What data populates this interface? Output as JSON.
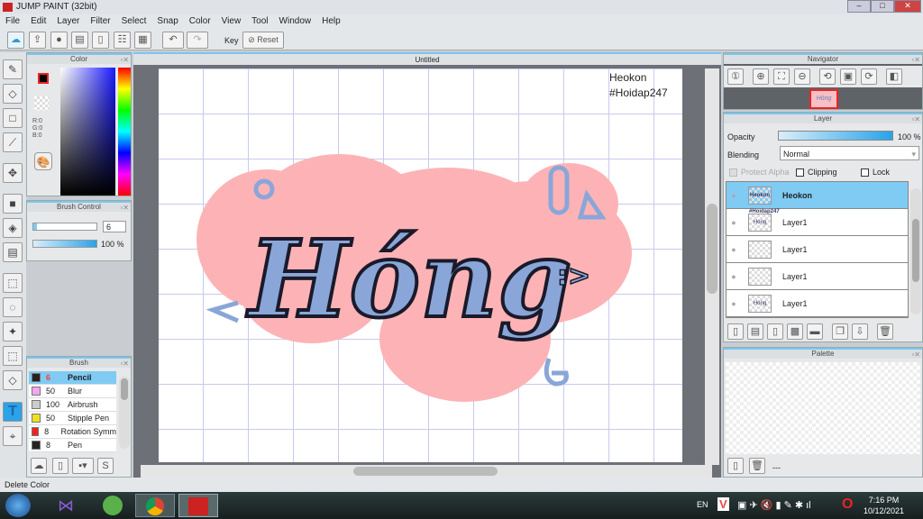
{
  "window": {
    "title": "JUMP PAINT (32bit)"
  },
  "menu": [
    "File",
    "Edit",
    "Layer",
    "Filter",
    "Select",
    "Snap",
    "Color",
    "View",
    "Tool",
    "Window",
    "Help"
  ],
  "toolbar": {
    "key_label": "Key",
    "reset_label": "Reset"
  },
  "color_panel": {
    "title": "Color",
    "r": "R:0",
    "g": "G:0",
    "b": "B:0",
    "fg": "#000000",
    "bg": "#ffffff"
  },
  "brush_control": {
    "title": "Brush Control",
    "size": "6",
    "opacity": "100 %"
  },
  "brush_panel": {
    "title": "Brush",
    "items": [
      {
        "size": "6",
        "name": "Pencil",
        "color": "#222222",
        "selected": true
      },
      {
        "size": "50",
        "name": "Blur",
        "color": "#f4a6f0"
      },
      {
        "size": "100",
        "name": "Airbrush",
        "color": "#cccccc"
      },
      {
        "size": "50",
        "name": "Stipple Pen",
        "color": "#f0e020"
      },
      {
        "size": "8",
        "name": "Rotation Symm",
        "color": "#ee2222"
      },
      {
        "size": "8",
        "name": "Pen",
        "color": "#222222"
      }
    ]
  },
  "document": {
    "tab": "Untitled",
    "watermark_line1": "Heokon",
    "watermark_line2": "#Hoidap247",
    "artwork_text": "Hóng",
    "artwork_emoticon": ":>",
    "colors": {
      "blob": "#fdb3b6",
      "letters": "#8aa6d8",
      "outline": "#1a1a2a"
    }
  },
  "navigator": {
    "title": "Navigator"
  },
  "layer_panel": {
    "title": "Layer",
    "opacity_label": "Opacity",
    "opacity_value": "100 %",
    "blending_label": "Blending",
    "blending_value": "Normal",
    "protect_alpha": "Protect Alpha",
    "clipping": "Clipping",
    "lock": "Lock",
    "layers": [
      {
        "name": "Heokon",
        "thumb": "Heokon #Hoidap247",
        "selected": true
      },
      {
        "name": "Layer1",
        "thumb": "Hóng"
      },
      {
        "name": "Layer1",
        "thumb": ""
      },
      {
        "name": "Layer1",
        "thumb": ""
      },
      {
        "name": "Layer1",
        "thumb": "Hóng"
      }
    ]
  },
  "palette": {
    "title": "Palette",
    "footer": "---"
  },
  "status": {
    "text": "Delete Color"
  },
  "taskbar": {
    "lang": "EN",
    "time": "7:16 PM",
    "date": "10/12/2021"
  },
  "accent": "#7fcbf3"
}
